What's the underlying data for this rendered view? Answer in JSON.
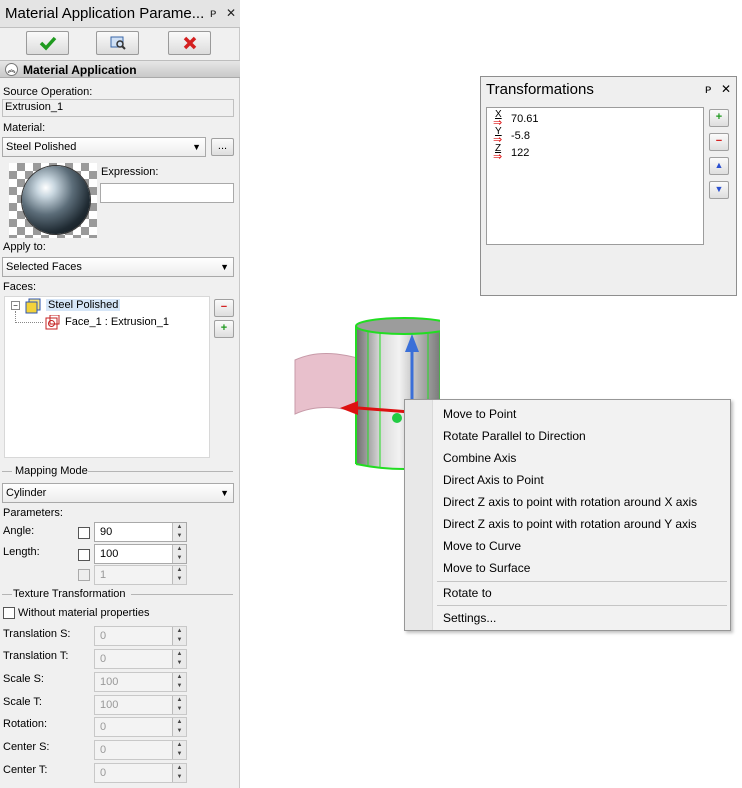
{
  "panel": {
    "title": "Material Application Parame...",
    "pin_glyph": "ᴘ",
    "close_glyph": "✕",
    "section_title": "Material Application",
    "source_operation_label": "Source Operation:",
    "source_operation_value": "Extrusion_1",
    "material_label": "Material:",
    "material_value": "Steel Polished",
    "browse_label": "...",
    "expression_label": "Expression:",
    "expression_value": "",
    "apply_to_label": "Apply to:",
    "apply_to_value": "Selected Faces",
    "faces_label": "Faces:",
    "tree": {
      "expander": "−",
      "root_label": "Steel Polished",
      "child_label": "Face_1 : Extrusion_1"
    },
    "mapping_mode_label": "Mapping Mode",
    "mapping_mode_value": "Cylinder",
    "parameters_label": "Parameters:",
    "angle_label": "Angle:",
    "angle_value": "90",
    "length_label": "Length:",
    "length_value": "100",
    "third_value": "1",
    "texture_label": "Texture Transformation",
    "without_material_label": "Without material properties",
    "translation_s_label": "Translation S:",
    "translation_s_value": "0",
    "translation_t_label": "Translation T:",
    "translation_t_value": "0",
    "scale_s_label": "Scale S:",
    "scale_s_value": "100",
    "scale_t_label": "Scale T:",
    "scale_t_value": "100",
    "rotation_label": "Rotation:",
    "rotation_value": "0",
    "center_s_label": "Center S:",
    "center_s_value": "0",
    "center_t_label": "Center T:",
    "center_t_value": "0"
  },
  "transformations": {
    "title": "Transformations",
    "rows": [
      {
        "axis": "X",
        "value": "70.61"
      },
      {
        "axis": "Y",
        "value": "-5.8"
      },
      {
        "axis": "Z",
        "value": "122"
      }
    ]
  },
  "context_menu": {
    "items": [
      "Move to Point",
      "Rotate Parallel to Direction",
      "Combine Axis",
      "Direct Axis to Point",
      "Direct Z axis to point with rotation around X axis",
      "Direct Z axis to point with rotation around Y axis",
      "Move to Curve",
      "Move to Surface",
      "Rotate to",
      "Settings..."
    ]
  },
  "colors": {
    "ok_green": "#1f9a1f",
    "cancel_red": "#d42020",
    "edge_green": "#22dd22",
    "axis_red": "#dd1111",
    "axis_blue": "#3a6fd8"
  }
}
